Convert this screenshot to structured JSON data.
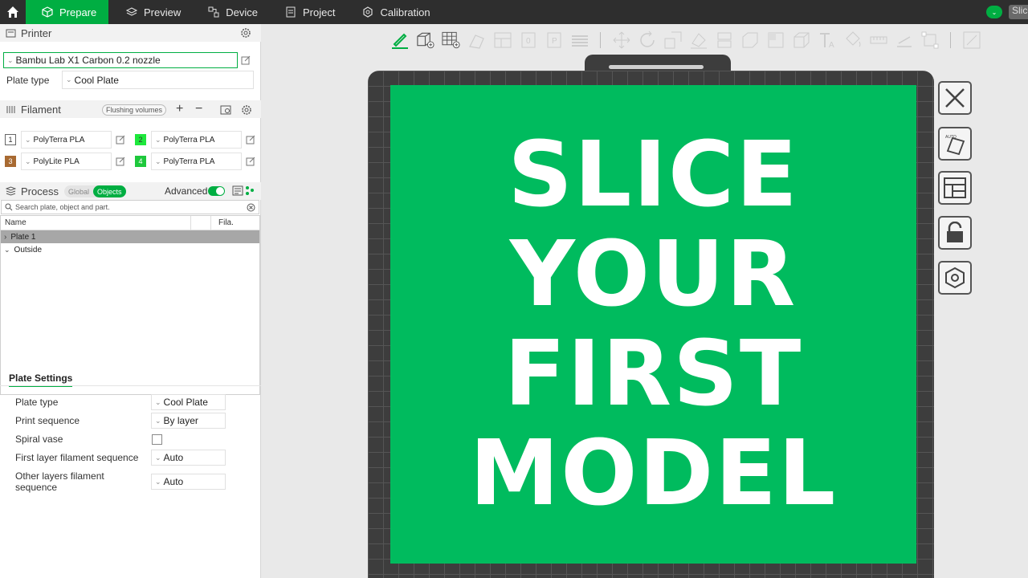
{
  "topbar": {
    "tabs": [
      {
        "label": "Prepare",
        "icon": "cube-icon",
        "active": true
      },
      {
        "label": "Preview",
        "icon": "layers-icon"
      },
      {
        "label": "Device",
        "icon": "device-icon"
      },
      {
        "label": "Project",
        "icon": "project-icon"
      },
      {
        "label": "Calibration",
        "icon": "calibration-icon"
      }
    ],
    "slice_label": "Slice",
    "accent": "#00ae42"
  },
  "printer": {
    "heading": "Printer",
    "selected": "Bambu Lab X1 Carbon 0.2 nozzle",
    "plate_type_label": "Plate type",
    "plate_type_value": "Cool Plate"
  },
  "filament": {
    "heading": "Filament",
    "flushing_label": "Flushing volumes",
    "slots": [
      {
        "num": "1",
        "name": "PolyTerra PLA",
        "color": "#ffffff"
      },
      {
        "num": "2",
        "name": "PolyTerra PLA",
        "color": "#1ee83c"
      },
      {
        "num": "3",
        "name": "PolyLite PLA",
        "color": "#a86a32"
      },
      {
        "num": "4",
        "name": "PolyTerra PLA",
        "color": "#1ec83c"
      }
    ]
  },
  "process": {
    "heading": "Process",
    "seg_global": "Global",
    "seg_objects": "Objects",
    "advanced_label": "Advanced",
    "search_placeholder": "Search plate, object and part.",
    "col_name": "Name",
    "col_fila": "Fila.",
    "rows": [
      "Plate 1",
      "Outside"
    ]
  },
  "plate_settings": {
    "title": "Plate Settings",
    "plate_type_label": "Plate type",
    "plate_type_value": "Cool Plate",
    "print_sequence_label": "Print sequence",
    "print_sequence_value": "By layer",
    "spiral_label": "Spiral vase",
    "first_layer_label": "First layer filament sequence",
    "first_layer_value": "Auto",
    "other_layers_label": "Other layers filament sequence",
    "other_layers_value": "Auto"
  },
  "banner": {
    "lines": [
      "SLICE",
      "YOUR",
      "FIRST",
      "MODEL"
    ],
    "color": "#00bb5e"
  }
}
